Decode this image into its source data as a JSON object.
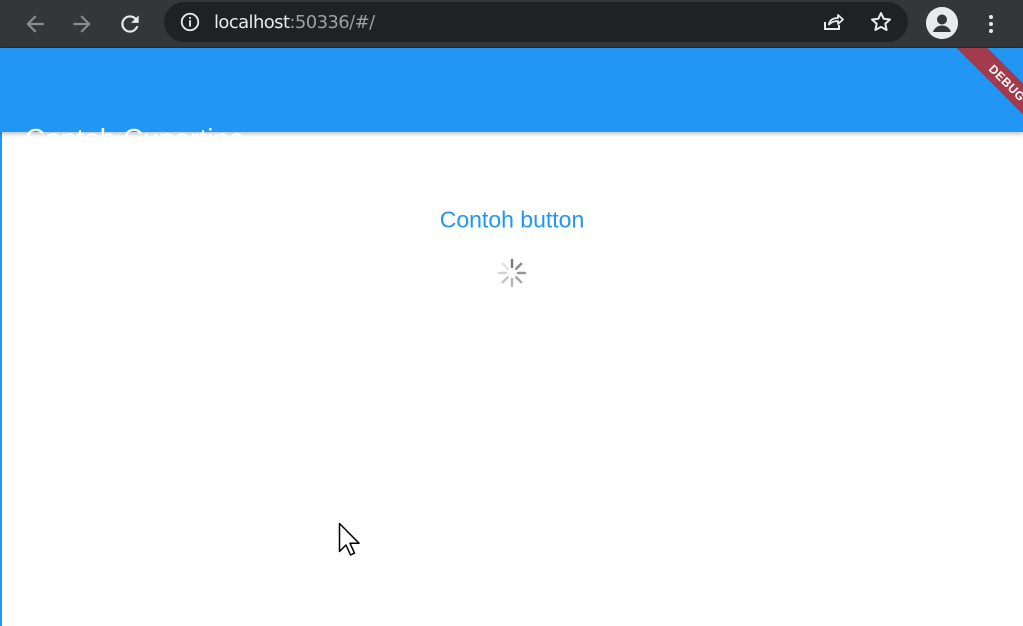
{
  "browser": {
    "url_host": "localhost",
    "url_rest": ":50336/#/",
    "icons": [
      "back-icon",
      "forward-icon",
      "reload-icon",
      "info-icon",
      "share-icon",
      "star-icon",
      "profile-icon",
      "more-vert-icon"
    ]
  },
  "app": {
    "title": "Contoh Cupertino",
    "button_label": "Contoh button",
    "debug_label": "DEBUG",
    "accent_color": "#2196f3",
    "banner_color": "#a33b4d"
  }
}
